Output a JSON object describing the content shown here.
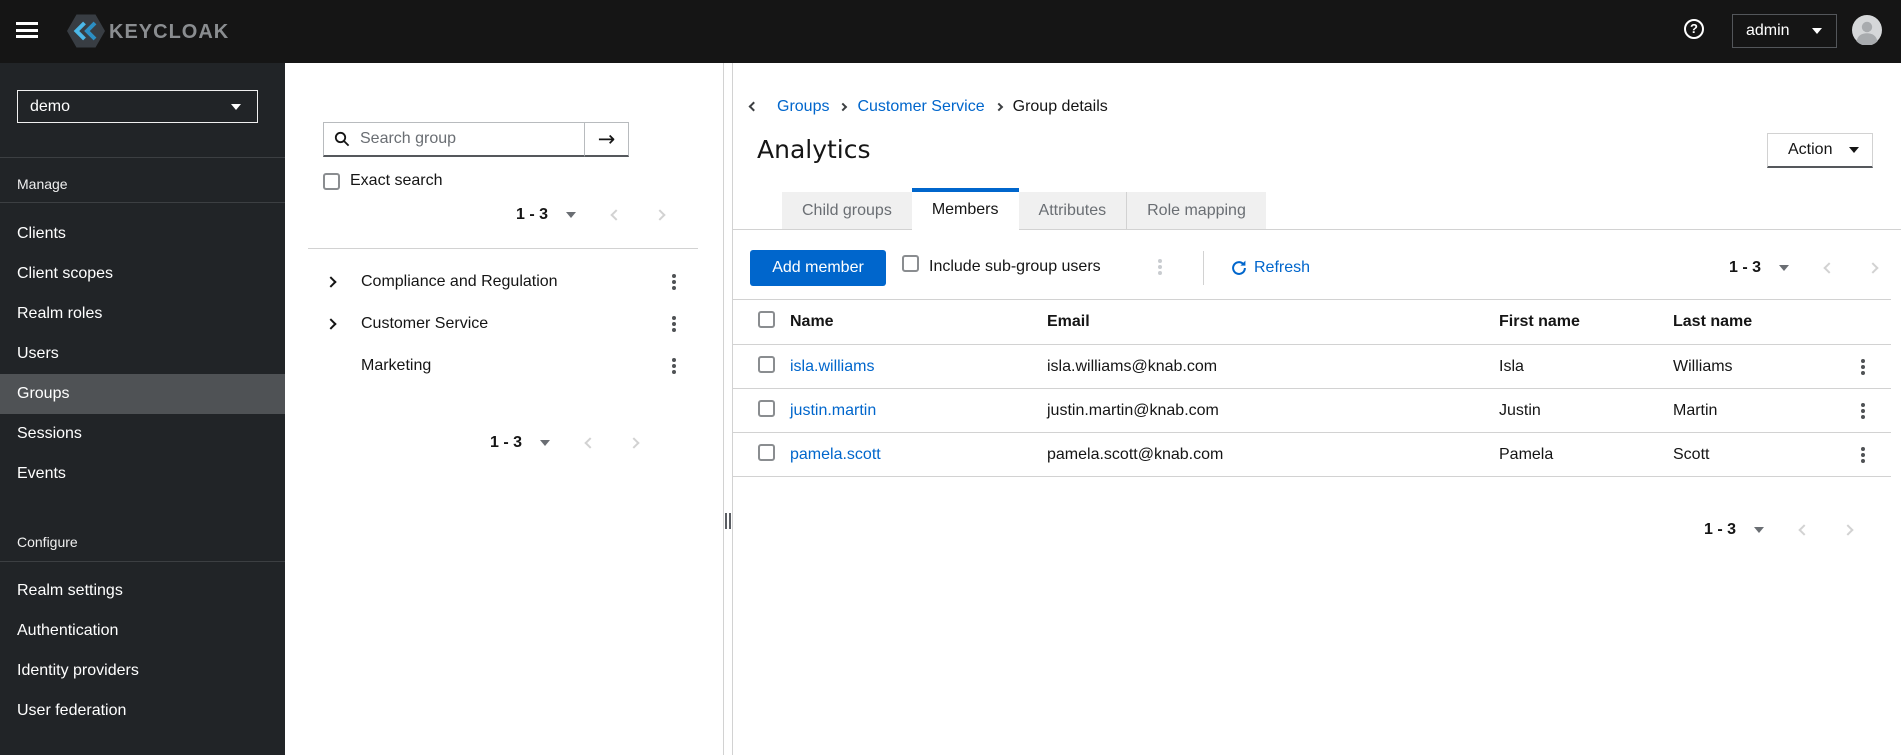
{
  "masthead": {
    "brand": "KEYCLOAK",
    "username": "admin"
  },
  "sidebar": {
    "realm": "demo",
    "manage_label": "Manage",
    "configure_label": "Configure",
    "manage_items": [
      "Clients",
      "Client scopes",
      "Realm roles",
      "Users",
      "Groups",
      "Sessions",
      "Events"
    ],
    "selected_item": "Groups",
    "configure_items": [
      "Realm settings",
      "Authentication",
      "Identity providers",
      "User federation"
    ]
  },
  "groups_panel": {
    "search_placeholder": "Search group",
    "exact_search_label": "Exact search",
    "pagination_top": "1 - 3",
    "pagination_bottom": "1 - 3",
    "items": [
      {
        "label": "Compliance and Regulation",
        "expandable": true
      },
      {
        "label": "Customer Service",
        "expandable": true
      },
      {
        "label": "Marketing",
        "expandable": false
      }
    ]
  },
  "main": {
    "breadcrumb": {
      "items": [
        "Groups",
        "Customer Service"
      ],
      "current": "Group details"
    },
    "title": "Analytics",
    "action_button": "Action",
    "tabs": [
      {
        "label": "Child groups",
        "active": false
      },
      {
        "label": "Members",
        "active": true
      },
      {
        "label": "Attributes",
        "active": false
      },
      {
        "label": "Role mapping",
        "active": false
      }
    ],
    "toolbar": {
      "add_member": "Add member",
      "include_subgroups": "Include sub-group users",
      "refresh": "Refresh",
      "pagination": "1 - 3"
    },
    "table": {
      "headers": [
        "Name",
        "Email",
        "First name",
        "Last name"
      ],
      "rows": [
        {
          "name": "isla.williams",
          "email": "isla.williams@knab.com",
          "first_name": "Isla",
          "last_name": "Williams"
        },
        {
          "name": "justin.martin",
          "email": "justin.martin@knab.com",
          "first_name": "Justin",
          "last_name": "Martin"
        },
        {
          "name": "pamela.scott",
          "email": "pamela.scott@knab.com",
          "first_name": "Pamela",
          "last_name": "Scott"
        }
      ]
    },
    "pagination_bottom": "1 - 3"
  },
  "icons": {
    "search_submit": "→"
  },
  "colors": {
    "accent": "#0066cc",
    "link": "#0066cc",
    "masthead_bg": "#151515",
    "sidebar_bg": "#212427",
    "selected_nav_bg": "#4f5255",
    "tab_inactive_bg": "#f0f0f0",
    "border": "#d2d2d2"
  }
}
